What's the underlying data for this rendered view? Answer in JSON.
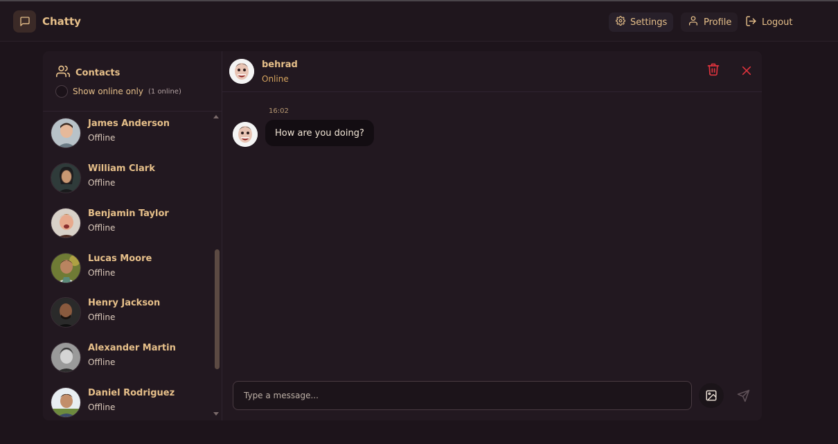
{
  "app": {
    "name": "Chatty"
  },
  "nav": {
    "settings": "Settings",
    "profile": "Profile",
    "logout": "Logout"
  },
  "sidebar": {
    "title": "Contacts",
    "filter_label": "Show online only",
    "online_count": "(1 online)",
    "contacts": [
      {
        "name": "James Anderson",
        "status": "Offline"
      },
      {
        "name": "William Clark",
        "status": "Offline"
      },
      {
        "name": "Benjamin Taylor",
        "status": "Offline"
      },
      {
        "name": "Lucas Moore",
        "status": "Offline"
      },
      {
        "name": "Henry Jackson",
        "status": "Offline"
      },
      {
        "name": "Alexander Martin",
        "status": "Offline"
      },
      {
        "name": "Daniel Rodriguez",
        "status": "Offline"
      }
    ]
  },
  "chat": {
    "user": "behrad",
    "status": "Online",
    "messages": [
      {
        "time": "16:02",
        "text": "How are you doing?"
      }
    ],
    "input_placeholder": "Type a message..."
  },
  "colors": {
    "background": "#1d141b",
    "panel": "#221820",
    "accent": "#e7c08a",
    "danger": "#e0333d"
  }
}
